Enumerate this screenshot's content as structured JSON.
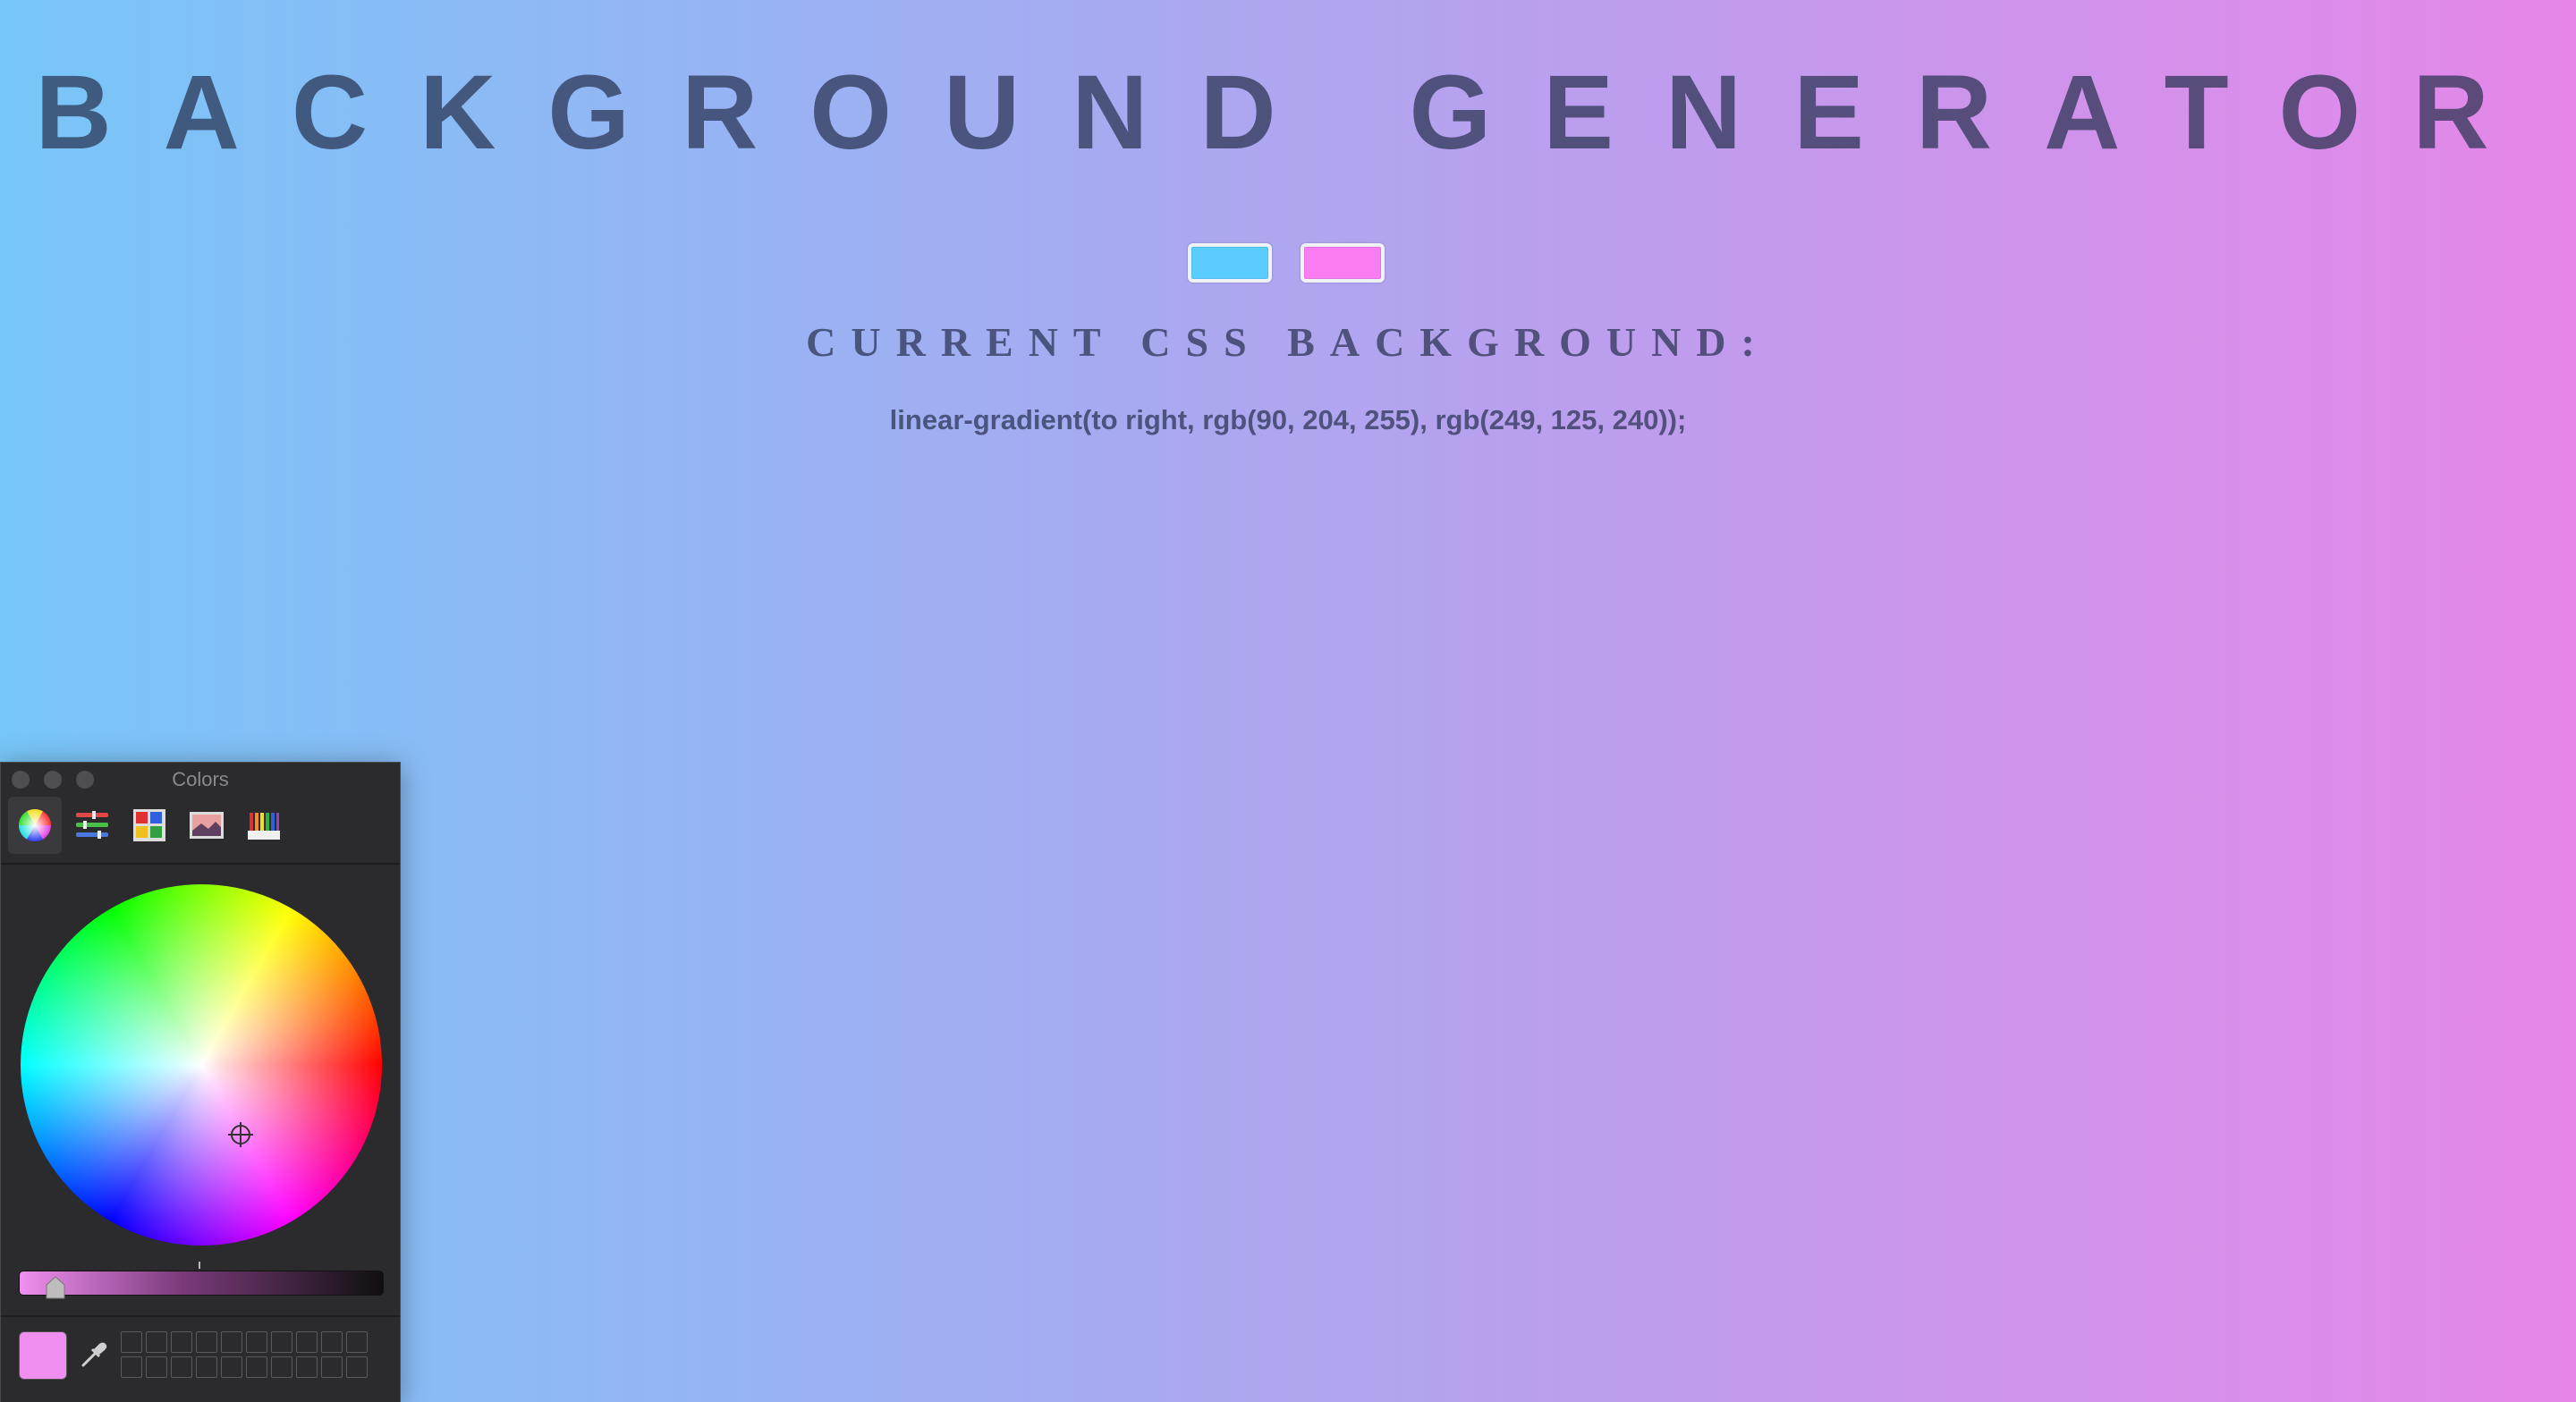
{
  "page": {
    "title": "BACKGROUND GENERATOR",
    "subtitle": "CURRENT CSS BACKGROUND:",
    "css_output": "linear-gradient(to right, rgb(90, 204, 255), rgb(249, 125, 240));"
  },
  "color_inputs": [
    {
      "name": "color1",
      "value": "#5accff"
    },
    {
      "name": "color2",
      "value": "#f97df0"
    }
  ],
  "colors_panel": {
    "title": "Colors",
    "tabs": [
      {
        "icon": "color-wheel-icon",
        "selected": true
      },
      {
        "icon": "color-sliders-icon",
        "selected": false
      },
      {
        "icon": "color-palettes-icon",
        "selected": false
      },
      {
        "icon": "image-palettes-icon",
        "selected": false
      },
      {
        "icon": "pencils-icon",
        "selected": false
      }
    ],
    "current_color": "#f08ff0",
    "brightness_level": 0.1,
    "swatch_slots": 20
  }
}
